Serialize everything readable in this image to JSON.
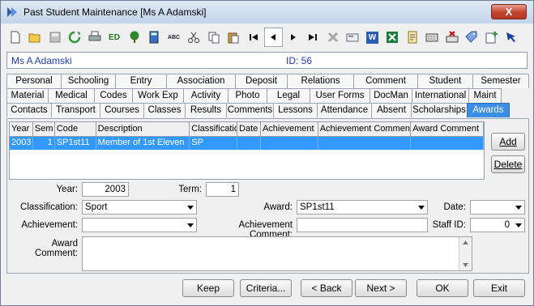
{
  "window": {
    "title": "Past Student Maintenance  [Ms A Adamski]",
    "close_label": "X"
  },
  "toolbar": {
    "buttons": [
      {
        "name": "new-icon"
      },
      {
        "name": "open-folder-icon"
      },
      {
        "name": "save-icon"
      },
      {
        "name": "refresh-icon"
      },
      {
        "name": "print-icon"
      },
      {
        "name": "ed-icon",
        "text": "ED"
      },
      {
        "name": "tree-icon"
      },
      {
        "name": "calculator-icon"
      },
      {
        "name": "spellcheck-icon",
        "text": "ABC"
      },
      {
        "name": "cut-icon"
      },
      {
        "name": "copy-icon"
      },
      {
        "name": "paste-icon"
      },
      {
        "name": "first-record-icon"
      },
      {
        "name": "previous-record-icon"
      },
      {
        "name": "next-record-icon"
      },
      {
        "name": "last-record-icon"
      },
      {
        "name": "delete-icon"
      },
      {
        "name": "card-icon"
      },
      {
        "name": "word-icon",
        "text": "W"
      },
      {
        "name": "excel-icon"
      },
      {
        "name": "report-icon"
      },
      {
        "name": "keyboard-icon"
      },
      {
        "name": "cross-stamp-icon"
      },
      {
        "name": "tag-icon"
      },
      {
        "name": "edit-add-icon"
      },
      {
        "name": "pointer-icon"
      }
    ]
  },
  "info": {
    "student_name": "Ms A Adamski",
    "id_text": "ID: 56"
  },
  "tabs": {
    "row1": [
      "Personal",
      "Schooling",
      "Entry",
      "Association",
      "Deposit",
      "Relations",
      "Comment",
      "Student",
      "Semester"
    ],
    "row2": [
      "Material",
      "Medical",
      "Codes",
      "Work Exp",
      "Activity",
      "Photo",
      "Legal",
      "User Forms",
      "DocMan",
      "International",
      "Maint"
    ],
    "row3": [
      "Contacts",
      "Transport",
      "Courses",
      "Classes",
      "Results",
      "Comments",
      "Lessons",
      "Attendance",
      "Absent",
      "Scholarships",
      "Awards"
    ],
    "active": "Awards"
  },
  "grid": {
    "columns": [
      "Year",
      "Sem",
      "Code",
      "Description",
      "Classification",
      "Date",
      "Achievement",
      "Achievement Comment",
      "Award Comment"
    ],
    "rows": [
      [
        "2003",
        "1",
        "SP1st11",
        "Member of 1st Eleven",
        "SP",
        "",
        "",
        "",
        ""
      ]
    ]
  },
  "side_buttons": {
    "add": "Add",
    "delete": "Delete"
  },
  "form": {
    "year_label": "Year:",
    "year_value": "2003",
    "term_label": "Term:",
    "term_value": "1",
    "classification_label": "Classification:",
    "classification_value": "Sport",
    "award_label": "Award:",
    "award_value": "SP1st11",
    "date_label": "Date:",
    "date_value": "",
    "achievement_label": "Achievement:",
    "achievement_value": "",
    "achievement_comment_label": "Achievement Comment:",
    "achievement_comment_value": "",
    "staff_id_label": "Staff ID:",
    "staff_id_value": "0",
    "award_comment_label": "Award Comment:",
    "award_comment_value": ""
  },
  "bottom_buttons": {
    "keep": "Keep",
    "criteria": "Criteria...",
    "back": "< Back",
    "next": "Next >",
    "ok": "OK",
    "exit": "Exit"
  },
  "colors": {
    "selection": "#3399ff",
    "active_tab": "#3a8ee6",
    "info_text": "#1f3fa8"
  }
}
